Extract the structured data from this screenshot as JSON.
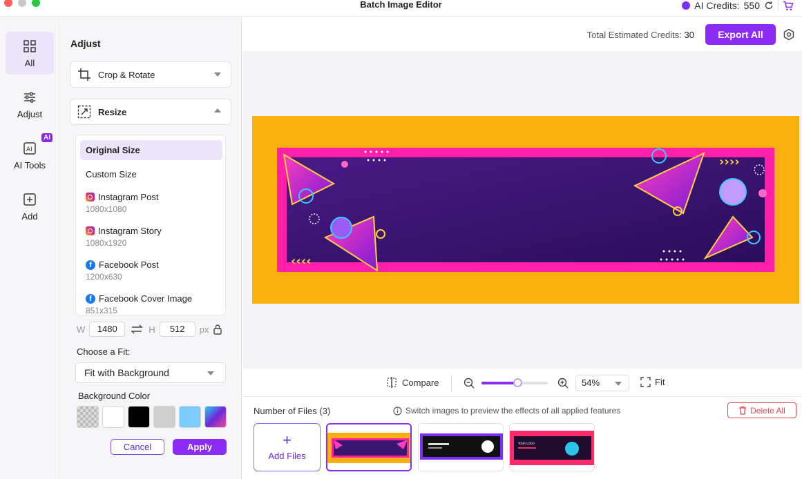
{
  "window": {
    "title": "Batch Image Editor"
  },
  "credits": {
    "label": "AI Credits:",
    "value": "550"
  },
  "nav": {
    "items": [
      {
        "label": "All",
        "icon": "grid-icon",
        "active": true
      },
      {
        "label": "Adjust",
        "icon": "sliders-icon",
        "active": false
      },
      {
        "label": "AI Tools",
        "icon": "ai-tools-icon",
        "active": false,
        "badge": "AI"
      },
      {
        "label": "Add",
        "icon": "add-square-icon",
        "active": false
      }
    ]
  },
  "panel": {
    "title": "Adjust",
    "crop_label": "Crop & Rotate",
    "resize_label": "Resize",
    "sizes": [
      {
        "name": "Original Size",
        "dim": "",
        "selected": true,
        "icon": ""
      },
      {
        "name": "Custom Size",
        "dim": "",
        "selected": false,
        "icon": ""
      },
      {
        "name": "Instagram Post",
        "dim": "1080x1080",
        "selected": false,
        "icon": "instagram-icon"
      },
      {
        "name": "Instagram Story",
        "dim": "1080x1920",
        "selected": false,
        "icon": "instagram-icon"
      },
      {
        "name": "Facebook Post",
        "dim": "1200x630",
        "selected": false,
        "icon": "facebook-icon"
      },
      {
        "name": "Facebook Cover Image",
        "dim": "851x315",
        "selected": false,
        "icon": "facebook-icon"
      }
    ],
    "width_label": "W",
    "width_value": "1480",
    "height_label": "H",
    "height_value": "512",
    "unit": "px",
    "fit_label": "Choose a Fit:",
    "fit_value": "Fit with Background",
    "bg_label": "Background Color",
    "swatches": [
      "transparent",
      "#ffffff",
      "#000000",
      "#cfcfcf",
      "#7ccbff",
      "gradient"
    ],
    "cancel": "Cancel",
    "apply": "Apply"
  },
  "header": {
    "estimated_label": "Total Estimated Credits:",
    "estimated_value": "30",
    "export_label": "Export All"
  },
  "preview": {
    "background_color": "#fbb00f",
    "banner_color": "#3a1670",
    "accent_color": "#ff1fa8"
  },
  "toolbar": {
    "compare": "Compare",
    "zoom": "54%",
    "zoom_level": 0.54,
    "fit": "Fit"
  },
  "files": {
    "count_label": "Number of Files (3)",
    "info": "Switch images to preview the effects of all applied features",
    "delete_all": "Delete All",
    "add_files": "Add Files",
    "thumbnails": [
      {
        "selected": true,
        "style": "orange-purple-banner"
      },
      {
        "selected": false,
        "style": "purple-black-banner"
      },
      {
        "selected": false,
        "style": "pink-logo-banner"
      }
    ],
    "thumb3_text": "YOUR LOGO"
  },
  "colors": {
    "accent": "#8b2cf5",
    "danger": "#e5484d"
  }
}
